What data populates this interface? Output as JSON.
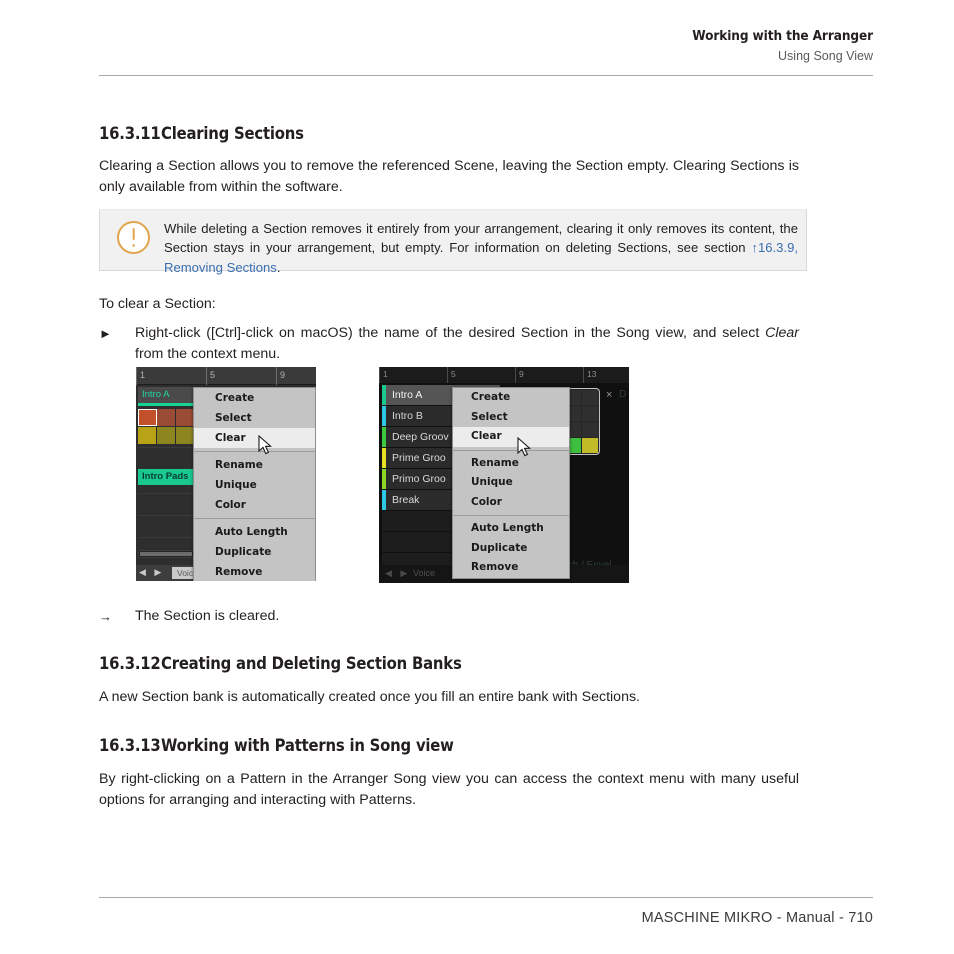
{
  "running_head": {
    "title": "Working with the Arranger",
    "subtitle": "Using Song View"
  },
  "footer": {
    "text": "MASCHINE MIKRO - Manual - 710"
  },
  "sections": [
    {
      "number": "16.3.11",
      "title": "Clearing Sections",
      "paragraph": "Clearing a Section allows you to remove the referenced Scene, leaving the Section empty. Clearing Sections is only available from within the software."
    },
    {
      "number": "16.3.12",
      "title": "Creating and Deleting Section Banks",
      "paragraph": "A new Section bank is automatically created once you fill an entire bank with Sections."
    },
    {
      "number": "16.3.13",
      "title": "Working with Patterns in Song view",
      "paragraph": "By right-clicking on a Pattern in the Arranger Song view you can access the context menu with many useful options for arranging and interacting with Patterns."
    }
  ],
  "note": {
    "icon": "warning-circle-icon",
    "text_before_link": "While deleting a Section removes it entirely from your arrangement, clearing it only removes its content, the Section stays in your arrangement, but empty. For information on deleting Sections, see section ",
    "link_text": "↑16.3.9, Removing Sections",
    "text_after_link": ".",
    "link_color": "#3a6fb0",
    "icon_color": "#e0a44c",
    "background": "#f1f1f2"
  },
  "procedure": {
    "intro": "To clear a Section:",
    "step_marker": "►",
    "step_text_1": "Right-click ([Ctrl]-click on macOS) the name of the desired Section in the Song view, and select ",
    "step_italic": "Clear",
    "step_text_2": " from the context menu.",
    "result_marker": "→",
    "result_text": "The Section is cleared."
  },
  "context_menu": {
    "items": [
      {
        "label": "Create",
        "submenu": false,
        "highlighted": false
      },
      {
        "label": "Select",
        "submenu": true,
        "highlighted": false
      },
      {
        "label": "Clear",
        "submenu": false,
        "highlighted": true
      },
      {
        "label": "Rename",
        "submenu": false,
        "highlighted": false
      },
      {
        "label": "Unique",
        "submenu": false,
        "highlighted": false
      },
      {
        "label": "Color",
        "submenu": true,
        "highlighted": false
      },
      {
        "label": "Auto Length",
        "submenu": false,
        "highlighted": false
      },
      {
        "label": "Duplicate",
        "submenu": false,
        "highlighted": false
      },
      {
        "label": "Remove",
        "submenu": false,
        "highlighted": false
      }
    ]
  },
  "screenshot_left": {
    "ruler_ticks": [
      "1",
      "5",
      "9"
    ],
    "section_name": "Intro A",
    "section_color": "#15d492",
    "pattern_label": "Intro Pads",
    "clip_rows": [
      {
        "colors": [
          "#c2502a",
          "#9a4b35",
          "#9a4b35",
          "#9a4b35"
        ],
        "selected_index": 0
      },
      {
        "colors": [
          "#b8a316",
          "#8d8520",
          "#8d8520",
          "#8d8520"
        ],
        "selected_index": -1
      }
    ],
    "bottom_tab": "Voice Settings / Engine",
    "nav_arrows": "◀ ▶"
  },
  "screenshot_right": {
    "ruler_ticks": [
      "1",
      "5",
      "9",
      "13"
    ],
    "scenes": [
      {
        "name": "Intro A",
        "color": "#19c98f",
        "active": true
      },
      {
        "name": "Intro B",
        "color": "#2ec7e8",
        "active": false
      },
      {
        "name": "Deep Groov",
        "color": "#3cc93c",
        "active": false
      },
      {
        "name": "Prime Groo",
        "color": "#e8e024",
        "active": false
      },
      {
        "name": "Primo Groo",
        "color": "#8fd624",
        "active": false
      },
      {
        "name": "Break",
        "color": "#2ec7e8",
        "active": false
      }
    ],
    "pad_colors": [
      "#2f2f2f",
      "#2f2f2f",
      "#2f2f2f",
      "#2f2f2f",
      "#2f2f2f",
      "#2f2f2f",
      "#2f2f2f",
      "#2f2f2f",
      "#2f2f2f",
      "#2f2f2f",
      "#2f2f2f",
      "#2f2f2f",
      "#2f2f2f",
      "#2f2f2f",
      "#3fbf3f",
      "#c2bb28"
    ],
    "close_label": "×",
    "faint_right_label": "D",
    "faint_bottom_label": "tch / Envel",
    "bottom_tab": "Voice",
    "nav_arrows": "◀ ▶"
  }
}
